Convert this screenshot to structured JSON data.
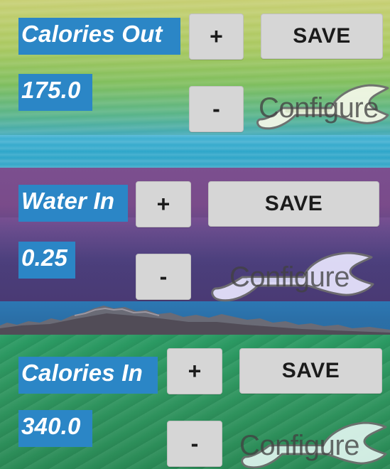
{
  "panels": [
    {
      "title": "Calories Out",
      "value": "175.0",
      "plus_label": "+",
      "minus_label": "-",
      "save_label": "SAVE",
      "configure_label": "Configure",
      "icon": "wrench-icon"
    },
    {
      "title": "Water In",
      "value": "0.25",
      "plus_label": "+",
      "minus_label": "-",
      "save_label": "SAVE",
      "configure_label": "Configure",
      "icon": "wrench-icon"
    },
    {
      "title": "Calories In",
      "value": "340.0",
      "plus_label": "+",
      "minus_label": "-",
      "save_label": "SAVE",
      "configure_label": "Configure",
      "icon": "wrench-icon"
    }
  ],
  "colors": {
    "label_bg": "#2b86c6",
    "label_text": "#ffffff",
    "button_bg": "#d6d6d6",
    "button_text": "#1b1b1b",
    "configure_text": "#414141"
  }
}
